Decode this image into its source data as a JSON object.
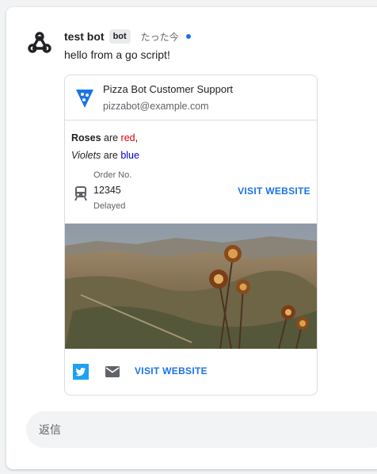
{
  "message": {
    "sender": "test bot",
    "badge": "bot",
    "timestamp": "たった今",
    "text": "hello from a go script!",
    "avatar_icon": "webhook-icon",
    "unread_dot_color": "#1a73e8"
  },
  "card": {
    "header": {
      "title": "Pizza Bot Customer Support",
      "subtitle": "pizzabot@example.com",
      "logo_icon": "map-pin-icon"
    },
    "paragraph1": {
      "part1": "Roses",
      "part2": " are ",
      "part3": "red",
      "part4": ","
    },
    "paragraph2": {
      "part1": "Violets",
      "part2": " are ",
      "part3": "blue"
    },
    "key_value": {
      "top_label": "Order No.",
      "content": "12345",
      "bottom_label": "Delayed",
      "icon": "train-icon",
      "button": "VISIT WEBSITE"
    },
    "image": {
      "icon": "thistle-landscape-image"
    },
    "buttons": {
      "twitter_icon": "twitter-icon",
      "email_icon": "email-icon",
      "text_button": "VISIT WEBSITE"
    }
  },
  "reply": {
    "placeholder": "返信"
  },
  "colors": {
    "accent": "#1a73e8",
    "red_text": "#e00000",
    "blue_text": "#0000d0"
  }
}
